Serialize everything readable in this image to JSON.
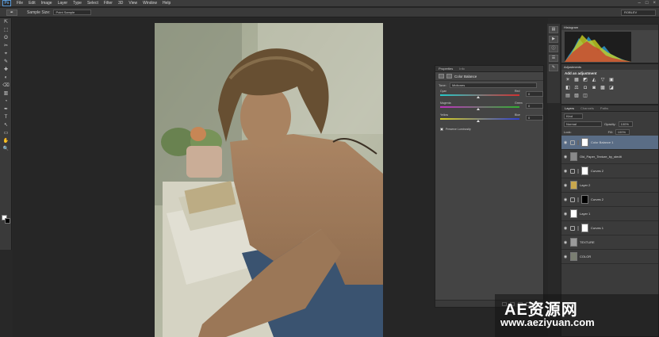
{
  "app": {
    "logo": "Ps"
  },
  "menu": [
    "File",
    "Edit",
    "Image",
    "Layer",
    "Type",
    "Select",
    "Filter",
    "3D",
    "View",
    "Window",
    "Help"
  ],
  "window_controls": [
    "–",
    "□",
    "×"
  ],
  "options": {
    "sample_size_label": "Sample Size:",
    "sample_size_value": "Point Sample"
  },
  "workspace": "ROBLEV",
  "tools": [
    "⇱",
    "⬚",
    "ʘ",
    "✂",
    "⌖",
    "✎",
    "✚",
    "◐",
    "⌫",
    "▥",
    "◔",
    "✒",
    "T",
    "↖",
    "▭",
    "✋",
    "🔍"
  ],
  "properties": {
    "tabs": [
      "Properties",
      "Info"
    ],
    "title": "Color Balance",
    "tone_label": "Tone:",
    "tone_value": "Midtones",
    "sliders": [
      {
        "left": "Cyan",
        "right": "Red",
        "value": "0",
        "position": 0.48,
        "gradient": [
          "#25c8c8",
          "#d03030"
        ]
      },
      {
        "left": "Magenta",
        "right": "Green",
        "value": "0",
        "position": 0.48,
        "gradient": [
          "#c030c0",
          "#30b030"
        ]
      },
      {
        "left": "Yellow",
        "right": "Blue",
        "value": "0",
        "position": 0.48,
        "gradient": [
          "#d8d020",
          "#3040d0"
        ]
      }
    ],
    "preserve_label": "Preserve Luminosity"
  },
  "histogram": {
    "tab": "Histogram"
  },
  "adjustments": {
    "tab": "Adjustments",
    "heading": "Add an adjustment",
    "icons": [
      "☀",
      "▦",
      "◩",
      "◭",
      "▽",
      "▣",
      "◧",
      "⚖",
      "◘",
      "◙",
      "▩",
      "◪",
      "▤",
      "▧",
      "◫"
    ]
  },
  "layers": {
    "tabs": [
      "Layers",
      "Channels",
      "Paths"
    ],
    "kind_label": "Kind",
    "blend_mode": "Normal",
    "opacity_label": "Opacity:",
    "opacity": "100%",
    "lock_label": "Lock:",
    "fill_label": "Fill:",
    "fill": "100%",
    "items": [
      {
        "name": "Color Balance 1",
        "type": "adjustment",
        "active": true,
        "thumb": "#ffffff"
      },
      {
        "name": "Old_Paper_Texture_by_stedit",
        "type": "image",
        "active": false,
        "thumb": "#8a8a8a"
      },
      {
        "name": "Curves 2",
        "type": "adjustment",
        "active": false,
        "thumb": "#ffffff"
      },
      {
        "name": "Layer 2",
        "type": "image",
        "active": false,
        "thumb": "#c9a74d"
      },
      {
        "name": "Curves 2",
        "type": "adjustment",
        "active": false,
        "thumb": "#000000"
      },
      {
        "name": "Layer 1",
        "type": "image",
        "active": false,
        "thumb": "#ffffff"
      },
      {
        "name": "Curves 1",
        "type": "adjustment",
        "active": false,
        "thumb": "#ffffff"
      },
      {
        "name": "TEXTURE",
        "type": "image",
        "active": false,
        "thumb": "#9a9a9a"
      },
      {
        "name": "COLOR",
        "type": "image",
        "active": false,
        "thumb": "#7b7f72"
      }
    ]
  },
  "watermark": {
    "big": "AE资源网",
    "small": "www.aeziyuan.com"
  }
}
